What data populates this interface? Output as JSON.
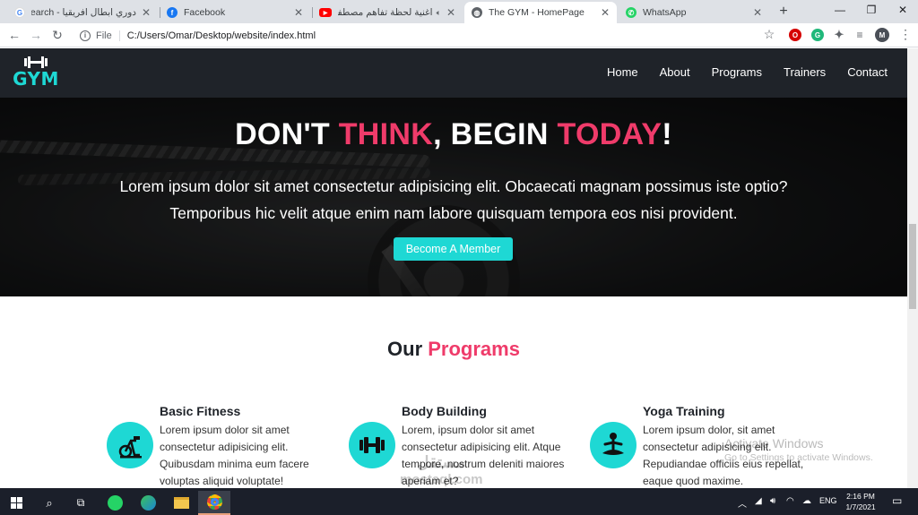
{
  "browser": {
    "tabs": [
      {
        "title": "دوري ابطال افريقيا - Google Search",
        "favicon_color": "#4285f4",
        "favicon_glyph": "G"
      },
      {
        "title": "Facebook",
        "favicon_color": "#1877f2",
        "favicon_glyph": "f"
      },
      {
        "title": "اغنية لحظة تفاهم مصطفى",
        "favicon_color": "#ff0000",
        "favicon_glyph": "▶"
      },
      {
        "title": "The GYM - HomePage",
        "favicon_color": "#5f6368",
        "favicon_glyph": "◍"
      },
      {
        "title": "WhatsApp",
        "favicon_color": "#25d366",
        "favicon_glyph": "✆"
      }
    ],
    "new_tab_label": "+",
    "address": {
      "scheme_label": "File",
      "url": "C:/Users/Omar/Desktop/website/index.html"
    },
    "profile_initial": "M"
  },
  "site": {
    "logo_text": "GYM",
    "nav": [
      "Home",
      "About",
      "Programs",
      "Trainers",
      "Contact"
    ],
    "hero": {
      "title_parts": [
        "DON'T ",
        "THINK",
        ", BEGIN ",
        "TODAY",
        "!"
      ],
      "text": "Lorem ipsum dolor sit amet consectetur adipisicing elit. Obcaecati magnam possimus iste optio? Temporibus hic velit atque enim nam labore quisquam tempora eos nisi provident.",
      "cta": "Become A Member"
    },
    "programs": {
      "title_parts": [
        "Our ",
        "Programs"
      ],
      "items": [
        {
          "name": "Basic Fitness",
          "icon": "exercise-bike-icon",
          "desc": "Lorem ipsum dolor sit amet consectetur adipisicing elit. Quibusdam minima eum facere voluptas aliquid voluptate!"
        },
        {
          "name": "Body Building",
          "icon": "dumbbell-icon",
          "desc": "Lorem, ipsum dolor sit amet consectetur adipisicing elit. Atque tempore, nostrum deleniti maiores aperiam et?"
        },
        {
          "name": "Yoga Training",
          "icon": "yoga-icon",
          "desc": "Lorem ipsum dolor, sit amet consectetur adipisicing elit. Repudiandae officiis eius repellat, eaque quod maxime."
        }
      ]
    },
    "accent_color": "#1ed8d4",
    "highlight_color": "#ef3b6a"
  },
  "overlays": {
    "activate_title": "Activate Windows",
    "activate_sub": "Go to Settings to activate Windows.",
    "watermark_ar": "مستقل",
    "watermark_en": "mostaql.com"
  },
  "taskbar": {
    "lang": "ENG",
    "time": "2:16 PM",
    "date": "1/7/2021"
  }
}
